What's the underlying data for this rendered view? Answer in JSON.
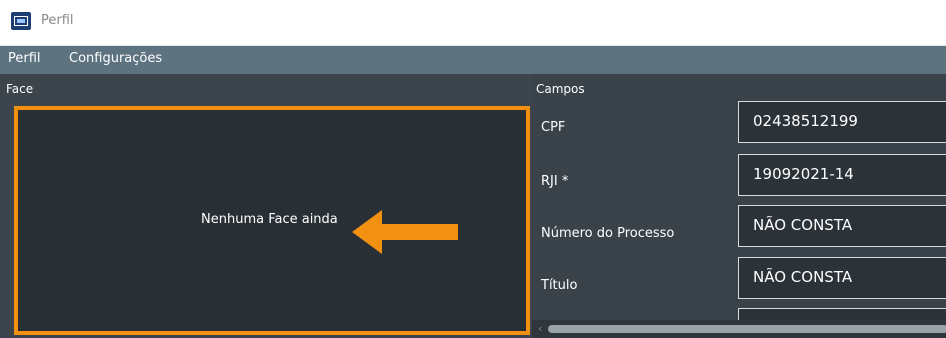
{
  "window": {
    "title": "Perfil"
  },
  "menu": {
    "items": [
      "Perfil",
      "Configurações"
    ]
  },
  "face_section": {
    "label": "Face",
    "placeholder": "Nenhuma Face ainda"
  },
  "fields_section": {
    "label": "Campos",
    "fields": [
      {
        "label": "CPF",
        "value": "02438512199"
      },
      {
        "label": "RJI *",
        "value": "19092021-14"
      },
      {
        "label": "Número do Processo",
        "value": "NÃO CONSTA"
      },
      {
        "label": "Título",
        "value": "NÃO CONSTA"
      }
    ]
  },
  "colors": {
    "accent_orange": "#f29111",
    "menubar": "#5d7380",
    "panel_dark": "#283036"
  },
  "icons": {
    "app": "app-icon",
    "arrow": "arrow-left-icon",
    "scroll_left": "chevron-left-icon"
  }
}
